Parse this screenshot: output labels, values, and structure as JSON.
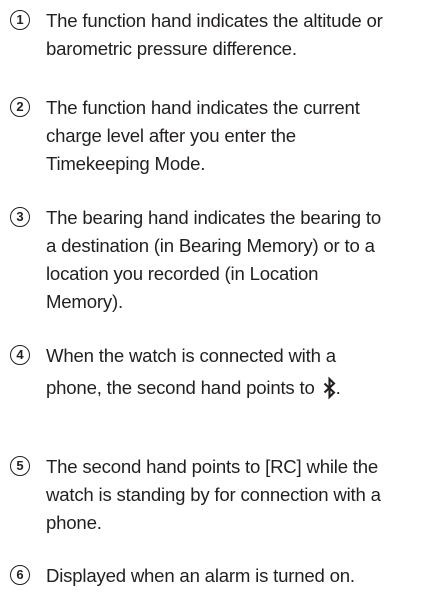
{
  "items": [
    {
      "number": "1",
      "lines": [
        "The function hand indicates the altitude or",
        "barometric pressure difference."
      ]
    },
    {
      "number": "2",
      "lines": [
        "The function hand indicates the current",
        "charge level after you enter the",
        "Timekeeping Mode."
      ]
    },
    {
      "number": "3",
      "lines": [
        "The bearing hand indicates the bearing to",
        "a destination (in Bearing Memory) or to a",
        "location you recorded (in Location",
        "Memory)."
      ]
    },
    {
      "number": "4",
      "lines": [
        "When the watch is connected with a",
        "phone, the second hand points to"
      ],
      "trailing_icon": "bluetooth-icon",
      "trailing_text": "."
    },
    {
      "number": "5",
      "lines": [
        "The second hand points to [RC] while the",
        "watch is standing by for connection with a",
        "phone."
      ]
    },
    {
      "number": "6",
      "lines": [
        "Displayed when an alarm is turned on."
      ]
    }
  ],
  "colors": {
    "text": "#231f20",
    "background": "#ffffff"
  }
}
